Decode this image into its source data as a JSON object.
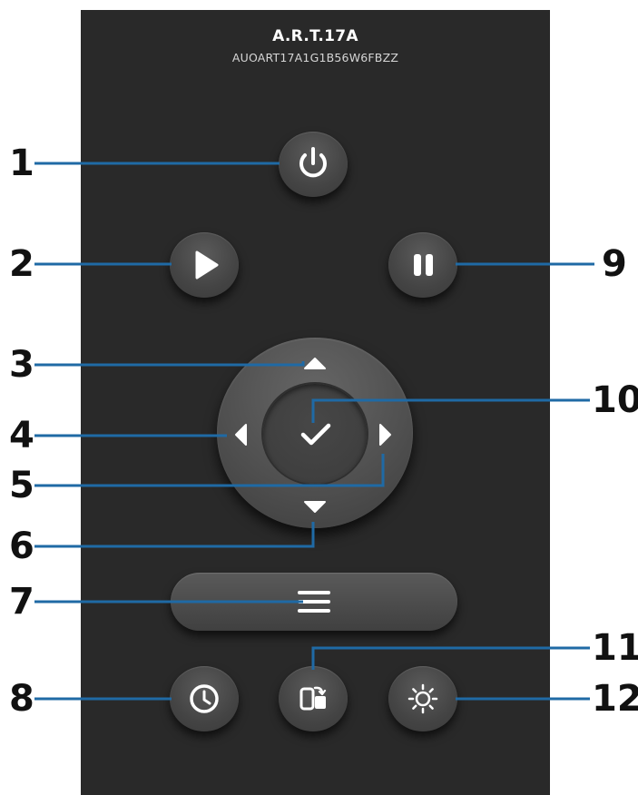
{
  "device": {
    "name": "A.R.T.17A",
    "serial": "AUOART17A1G1B56W6FBZZ"
  },
  "callout_color": "#1f6aa5",
  "callouts": {
    "n1": "1",
    "n2": "2",
    "n3": "3",
    "n4": "4",
    "n5": "5",
    "n6": "6",
    "n7": "7",
    "n8": "8",
    "n9": "9",
    "n10": "10",
    "n11": "11",
    "n12": "12"
  },
  "buttons": [
    {
      "name": "power-button",
      "icon": "power-icon"
    },
    {
      "name": "play-button",
      "icon": "play-icon"
    },
    {
      "name": "pause-button",
      "icon": "pause-icon"
    },
    {
      "name": "up-arrow-button",
      "icon": "triangle-up-icon"
    },
    {
      "name": "left-arrow-button",
      "icon": "triangle-left-icon"
    },
    {
      "name": "ok-button",
      "icon": "checkmark-icon"
    },
    {
      "name": "right-arrow-button",
      "icon": "triangle-right-icon"
    },
    {
      "name": "down-arrow-button",
      "icon": "triangle-down-icon"
    },
    {
      "name": "menu-button",
      "icon": "hamburger-menu-icon"
    },
    {
      "name": "timer-button",
      "icon": "clock-icon"
    },
    {
      "name": "source-button",
      "icon": "source-switch-icon"
    },
    {
      "name": "brightness-button",
      "icon": "sun-icon"
    }
  ]
}
